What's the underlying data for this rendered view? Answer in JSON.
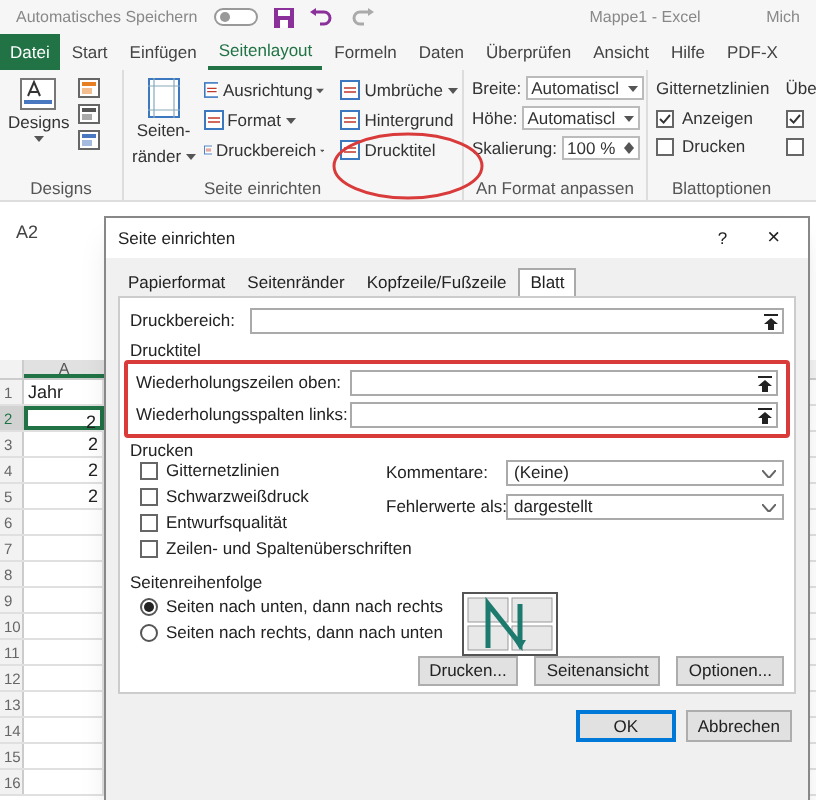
{
  "title_bar": {
    "autosave_label": "Automatisches Speichern",
    "autosave_on": false,
    "title": "Mappe1 - Excel",
    "user": "Mich"
  },
  "ribbon_tabs": [
    {
      "label": "Datei",
      "kind": "file"
    },
    {
      "label": "Start",
      "kind": "tab",
      "selected": false
    },
    {
      "label": "Einfügen",
      "kind": "tab",
      "selected": false
    },
    {
      "label": "Seitenlayout",
      "kind": "tab",
      "selected": true
    },
    {
      "label": "Formeln",
      "kind": "tab",
      "selected": false
    },
    {
      "label": "Daten",
      "kind": "tab",
      "selected": false
    },
    {
      "label": "Überprüfen",
      "kind": "tab",
      "selected": false
    },
    {
      "label": "Ansicht",
      "kind": "tab",
      "selected": false
    },
    {
      "label": "Hilfe",
      "kind": "tab",
      "selected": false
    },
    {
      "label": "PDF-X",
      "kind": "tab",
      "selected": false
    }
  ],
  "ribbon": {
    "designs": {
      "button": "Designs",
      "label": "Designs"
    },
    "page_setup": {
      "margins": [
        "Seiten-",
        "ränder"
      ],
      "label": "Seite einrichten",
      "commands": [
        {
          "label": "Ausrichtung",
          "dropdown": true
        },
        {
          "label": "Format",
          "dropdown": true
        },
        {
          "label": "Druckbereich",
          "dropdown": true
        },
        {
          "label": "Umbrüche",
          "dropdown": true
        },
        {
          "label": "Hintergrund",
          "dropdown": false
        },
        {
          "label": "Drucktitel",
          "dropdown": false
        }
      ]
    },
    "scale": {
      "label": "An Format anpassen",
      "fields": [
        {
          "label": "Breite:",
          "value": "Automatiscl",
          "kind": "dropdown"
        },
        {
          "label": "Höhe:",
          "value": "Automatiscl",
          "kind": "dropdown"
        },
        {
          "label": "Skalierung:",
          "value": "100 %",
          "kind": "spin"
        }
      ]
    },
    "sheet_options": {
      "label": "Blattoptionen",
      "columns": [
        {
          "heading": "Gitternetzlinien",
          "options": [
            {
              "label": "Anzeigen",
              "checked": true
            },
            {
              "label": "Drucken",
              "checked": false
            }
          ]
        },
        {
          "heading": "Übe",
          "options": [
            {
              "checked": true
            },
            {
              "checked": false
            }
          ]
        }
      ]
    }
  },
  "name_box": "A2",
  "sheet": {
    "columns": [
      "A"
    ],
    "rows": [
      {
        "number": "1",
        "cell": "Jahr",
        "selected": false
      },
      {
        "number": "2",
        "cell": "2",
        "selected": true
      },
      {
        "number": "3",
        "cell": "2",
        "selected": false
      },
      {
        "number": "4",
        "cell": "2",
        "selected": false
      },
      {
        "number": "5",
        "cell": "2",
        "selected": false
      },
      {
        "number": "6",
        "selected": false
      },
      {
        "number": "7",
        "selected": false
      },
      {
        "number": "8",
        "selected": false
      },
      {
        "number": "9",
        "selected": false
      },
      {
        "number": "10",
        "selected": false
      },
      {
        "number": "11",
        "selected": false
      },
      {
        "number": "12",
        "selected": false
      },
      {
        "number": "13",
        "selected": false
      },
      {
        "number": "14",
        "selected": false
      },
      {
        "number": "15",
        "selected": false
      },
      {
        "number": "16",
        "selected": false
      }
    ]
  },
  "dialog": {
    "title": "Seite einrichten",
    "help": "?",
    "close": "×",
    "tabs": [
      {
        "label": "Papierformat",
        "selected": false
      },
      {
        "label": "Seitenränder",
        "selected": false
      },
      {
        "label": "Kopfzeile/Fußzeile",
        "selected": false
      },
      {
        "label": "Blatt",
        "selected": true
      }
    ],
    "print_area": {
      "label": "Druckbereich:"
    },
    "print_titles": {
      "heading": "Drucktitel",
      "highlighted": true,
      "fields": [
        {
          "label": "Wiederholungszeilen oben:"
        },
        {
          "label": "Wiederholungsspalten links:"
        }
      ]
    },
    "print": {
      "heading": "Drucken",
      "options": [
        {
          "label": "Gitternetzlinien",
          "checked": false
        },
        {
          "label": "Schwarzweißdruck",
          "checked": false
        },
        {
          "label": "Entwurfsqualität",
          "checked": false
        },
        {
          "label": "Zeilen- und Spaltenüberschriften",
          "checked": false
        }
      ],
      "selects": [
        {
          "label": "Kommentare:",
          "value": "(Keine)"
        },
        {
          "label": "Fehlerwerte als:",
          "value": "dargestellt"
        }
      ]
    },
    "page_order": {
      "heading": "Seitenreihenfolge",
      "options": [
        {
          "label": "Seiten nach unten, dann nach rechts",
          "selected": true
        },
        {
          "label": "Seiten nach rechts, dann nach unten",
          "selected": false
        }
      ]
    },
    "buttons": [
      "Drucken...",
      "Seitenansicht",
      "Optionen..."
    ],
    "footer_buttons": [
      {
        "label": "OK",
        "default": true
      },
      {
        "label": "Abbrechen",
        "default": false
      }
    ]
  }
}
